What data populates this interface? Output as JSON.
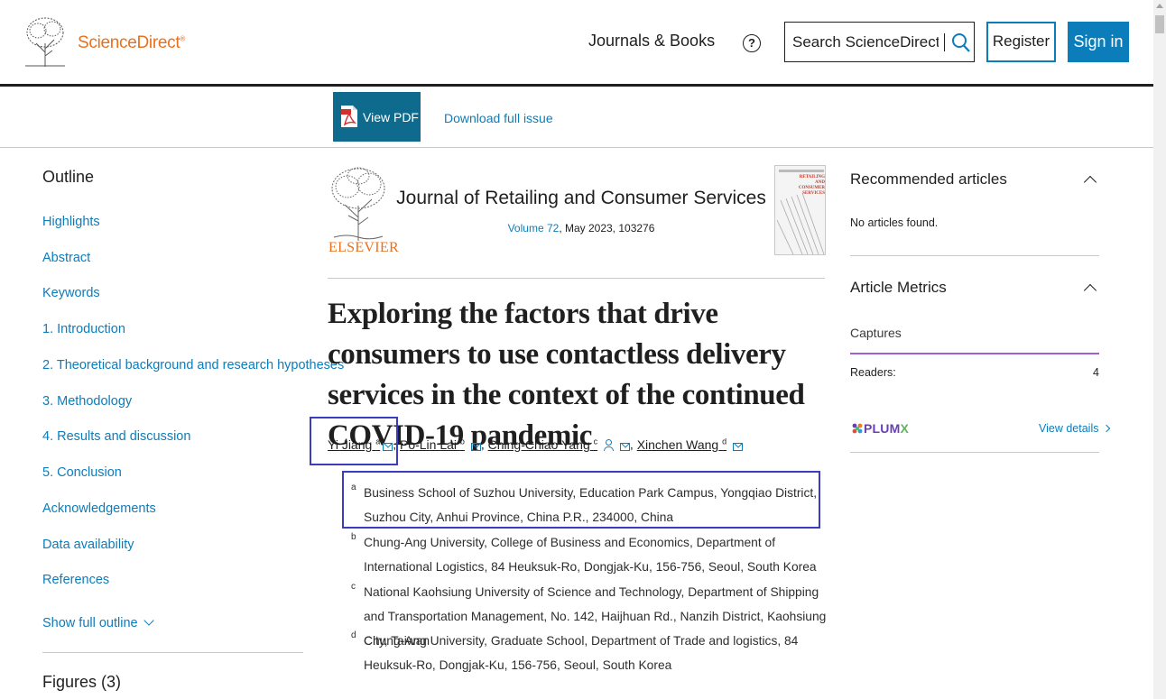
{
  "header": {
    "brand": "ScienceDirect",
    "brand_mark": "®",
    "nav_journals": "Journals & Books",
    "help_symbol": "?",
    "search_placeholder": "Search ScienceDirect",
    "register_label": "Register",
    "signin_label": "Sign in"
  },
  "toolbar": {
    "view_pdf_label": "View PDF",
    "download_label": "Download full issue"
  },
  "outline": {
    "title": "Outline",
    "items": [
      "Highlights",
      "Abstract",
      "Keywords",
      "1. Introduction",
      "2. Theoretical background and research hypotheses",
      "3. Methodology",
      "4. Results and discussion",
      "5. Conclusion",
      "Acknowledgements",
      "Data availability",
      "References"
    ],
    "show_full": "Show full outline",
    "figures_title": "Figures (3)"
  },
  "journal": {
    "publisher": "ELSEVIER",
    "title": "Journal of Retailing and Consumer Services",
    "volume_link": "Volume 72",
    "volume_rest": ", May 2023, 103276",
    "cover_text": "RETAILING AND CONSUMER SERVICES"
  },
  "article": {
    "title": "Exploring the factors that drive consumers to use contactless delivery services in the context of the continued COVID-19 pandemic",
    "authors": [
      {
        "name": "Yi Jiang",
        "sup": "a"
      },
      {
        "name": "Po-Lin Lai",
        "sup": "b"
      },
      {
        "name": "Ching-Chiao Yang",
        "sup": "c"
      },
      {
        "name": "Xinchen Wang",
        "sup": "d"
      }
    ],
    "separator": ",",
    "affiliations": [
      {
        "letter": "a",
        "text": "Business School of Suzhou University, Education Park Campus, Yongqiao District, Suzhou City, Anhui Province, China P.R., 234000, China"
      },
      {
        "letter": "b",
        "text": "Chung-Ang University, College of Business and Economics, Department of International Logistics, 84 Heuksuk-Ro, Dongjak-Ku, 156-756, Seoul, South Korea"
      },
      {
        "letter": "c",
        "text": "National Kaohsiung University of Science and Technology, Department of Shipping and Transportation Management, No. 142, Haijhuan Rd., Nanzih District, Kaohsiung City, Taiwan"
      },
      {
        "letter": "d",
        "text": "Chung-Ang University, Graduate School, Department of Trade and logistics, 84 Heuksuk-Ro, Dongjak-Ku, 156-756, Seoul, South Korea"
      }
    ]
  },
  "sidebar": {
    "recommended_title": "Recommended articles",
    "recommended_empty": "No articles found.",
    "metrics_title": "Article Metrics",
    "captures_label": "Captures",
    "readers_label": "Readers:",
    "readers_value": "4",
    "plumx_brand": "PLUM",
    "plumx_x": "X",
    "view_details": "View details"
  },
  "colors": {
    "brand_orange": "#e9711c",
    "link_blue": "#0c7dbb",
    "pdf_button": "#0e6b8e",
    "highlight_box": "#3c3cbf",
    "captures_purple": "#a15cd6"
  }
}
